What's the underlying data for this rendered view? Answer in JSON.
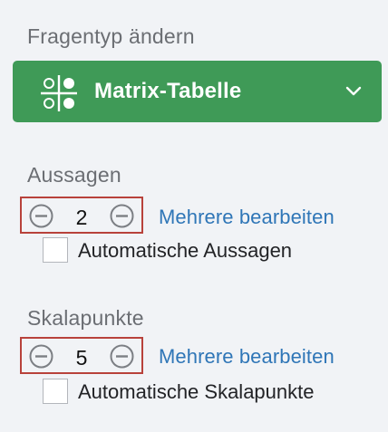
{
  "panel": {
    "question_type_heading": "Fragentyp ändern",
    "question_type": {
      "label": "Matrix-Tabelle",
      "icon": "matrix-table-icon",
      "dropdown_icon": "chevron-down-icon",
      "color": "#3f9a57"
    },
    "statements": {
      "heading": "Aussagen",
      "value": "2",
      "decrement_icon": "minus-circle-icon",
      "increment_icon": "minus-circle-icon",
      "edit_multiple_label": "Mehrere bearbeiten",
      "auto_checkbox_label": "Automatische Aussagen",
      "auto_checked": false
    },
    "scale_points": {
      "heading": "Skalapunkte",
      "value": "5",
      "decrement_icon": "minus-circle-icon",
      "increment_icon": "minus-circle-icon",
      "edit_multiple_label": "Mehrere bearbeiten",
      "auto_checkbox_label": "Automatische Skalapunkte",
      "auto_checked": false
    },
    "colors": {
      "background": "#f1f3f6",
      "heading_text": "#6b6e73",
      "link": "#2f76b7",
      "stepper_border": "#b8423b"
    }
  }
}
